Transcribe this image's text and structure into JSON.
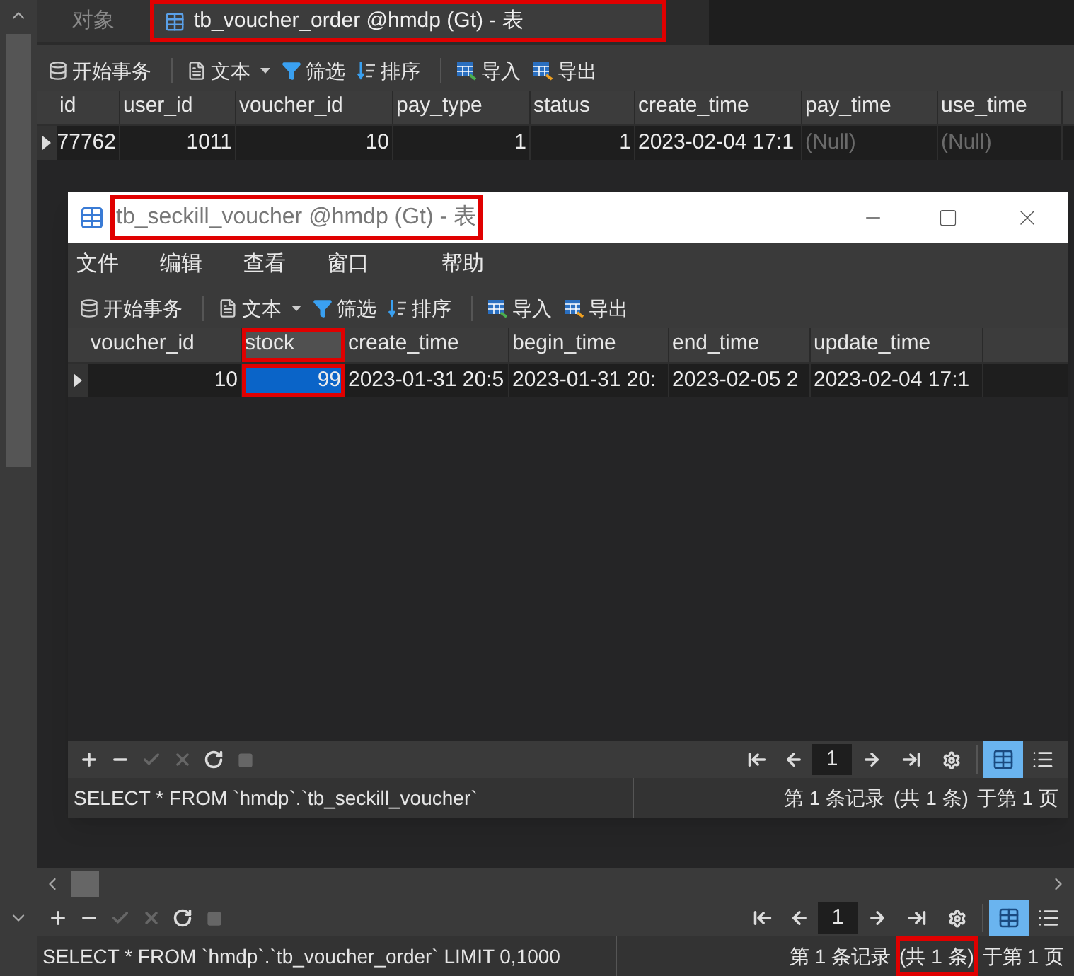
{
  "main": {
    "tabs": [
      {
        "label": "对象",
        "selected": false,
        "highlighted": false
      },
      {
        "label": "tb_voucher_order @hmdp (Gt) - 表",
        "selected": true,
        "highlighted": true
      }
    ],
    "toolbar": [
      {
        "kind": "transaction",
        "label": "开始事务"
      },
      {
        "kind": "text",
        "label": "文本"
      },
      {
        "kind": "filter",
        "label": "筛选"
      },
      {
        "kind": "sort",
        "label": "排序"
      },
      {
        "kind": "import",
        "label": "导入"
      },
      {
        "kind": "export",
        "label": "导出"
      }
    ],
    "columns": [
      {
        "label": "id",
        "highlighted": false
      },
      {
        "label": "user_id",
        "highlighted": false
      },
      {
        "label": "voucher_id",
        "highlighted": false
      },
      {
        "label": "pay_type",
        "highlighted": false
      },
      {
        "label": "status",
        "highlighted": false
      },
      {
        "label": "create_time",
        "highlighted": false
      },
      {
        "label": "pay_time",
        "highlighted": false
      },
      {
        "label": "use_time",
        "highlighted": false
      }
    ],
    "rows": [
      {
        "cells": [
          {
            "value": "77762",
            "kind": "number",
            "selected": false
          },
          {
            "value": "1011",
            "kind": "number",
            "selected": false
          },
          {
            "value": "10",
            "kind": "number",
            "selected": false
          },
          {
            "value": "1",
            "kind": "number",
            "selected": false
          },
          {
            "value": "1",
            "kind": "number",
            "selected": false
          },
          {
            "value": "2023-02-04 17:1",
            "kind": "text",
            "selected": false
          },
          {
            "value": "(Null)",
            "kind": "null",
            "selected": false
          },
          {
            "value": "(Null)",
            "kind": "null",
            "selected": false
          }
        ]
      }
    ],
    "nav": {
      "buttons": [
        {
          "kind": "add",
          "disabled": false
        },
        {
          "kind": "remove",
          "disabled": false
        },
        {
          "kind": "apply",
          "disabled": true
        },
        {
          "kind": "discard",
          "disabled": true
        },
        {
          "kind": "refresh",
          "disabled": false
        },
        {
          "kind": "stop",
          "disabled": true
        }
      ],
      "page": "1",
      "views": [
        {
          "kind": "grid",
          "selected": true
        },
        {
          "kind": "form",
          "selected": false
        }
      ]
    },
    "status": {
      "sql": "SELECT * FROM `hmdp`.`tb_voucher_order` LIMIT 0,1000",
      "record": [
        {
          "text": "第 1 条记录",
          "highlighted": false
        },
        {
          "text": "(共 1 条)",
          "highlighted": true
        },
        {
          "text": "于第 1 页",
          "highlighted": false
        }
      ]
    }
  },
  "window": {
    "title": "tb_seckill_voucher @hmdp (Gt) - 表",
    "title_highlighted": true,
    "menu": [
      "文件",
      "编辑",
      "查看",
      "窗口",
      "帮助"
    ],
    "toolbar": [
      {
        "kind": "transaction",
        "label": "开始事务"
      },
      {
        "kind": "text",
        "label": "文本"
      },
      {
        "kind": "filter",
        "label": "筛选"
      },
      {
        "kind": "sort",
        "label": "排序"
      },
      {
        "kind": "import",
        "label": "导入"
      },
      {
        "kind": "export",
        "label": "导出"
      }
    ],
    "columns": [
      {
        "label": "voucher_id",
        "highlighted": false
      },
      {
        "label": "stock",
        "highlighted": true
      },
      {
        "label": "create_time",
        "highlighted": false
      },
      {
        "label": "begin_time",
        "highlighted": false
      },
      {
        "label": "end_time",
        "highlighted": false
      },
      {
        "label": "update_time",
        "highlighted": false
      }
    ],
    "rows": [
      {
        "cells": [
          {
            "value": "10",
            "kind": "number",
            "selected": false
          },
          {
            "value": "99",
            "kind": "number",
            "selected": true
          },
          {
            "value": "2023-01-31 20:5",
            "kind": "text",
            "selected": false
          },
          {
            "value": "2023-01-31 20:",
            "kind": "text",
            "selected": false
          },
          {
            "value": "2023-02-05 2",
            "kind": "text",
            "selected": false
          },
          {
            "value": "2023-02-04 17:1",
            "kind": "text",
            "selected": false
          }
        ]
      }
    ],
    "nav": {
      "buttons": [
        {
          "kind": "add",
          "disabled": false
        },
        {
          "kind": "remove",
          "disabled": false
        },
        {
          "kind": "apply",
          "disabled": true
        },
        {
          "kind": "discard",
          "disabled": true
        },
        {
          "kind": "refresh",
          "disabled": false
        },
        {
          "kind": "stop",
          "disabled": true
        }
      ],
      "page": "1",
      "views": [
        {
          "kind": "grid",
          "selected": true
        },
        {
          "kind": "form",
          "selected": false
        }
      ]
    },
    "status": {
      "sql": "SELECT * FROM `hmdp`.`tb_seckill_voucher`",
      "record": [
        {
          "text": "第 1 条记录",
          "highlighted": false
        },
        {
          "text": "(共 1 条)",
          "highlighted": false
        },
        {
          "text": "于第 1 页",
          "highlighted": false
        }
      ]
    }
  }
}
